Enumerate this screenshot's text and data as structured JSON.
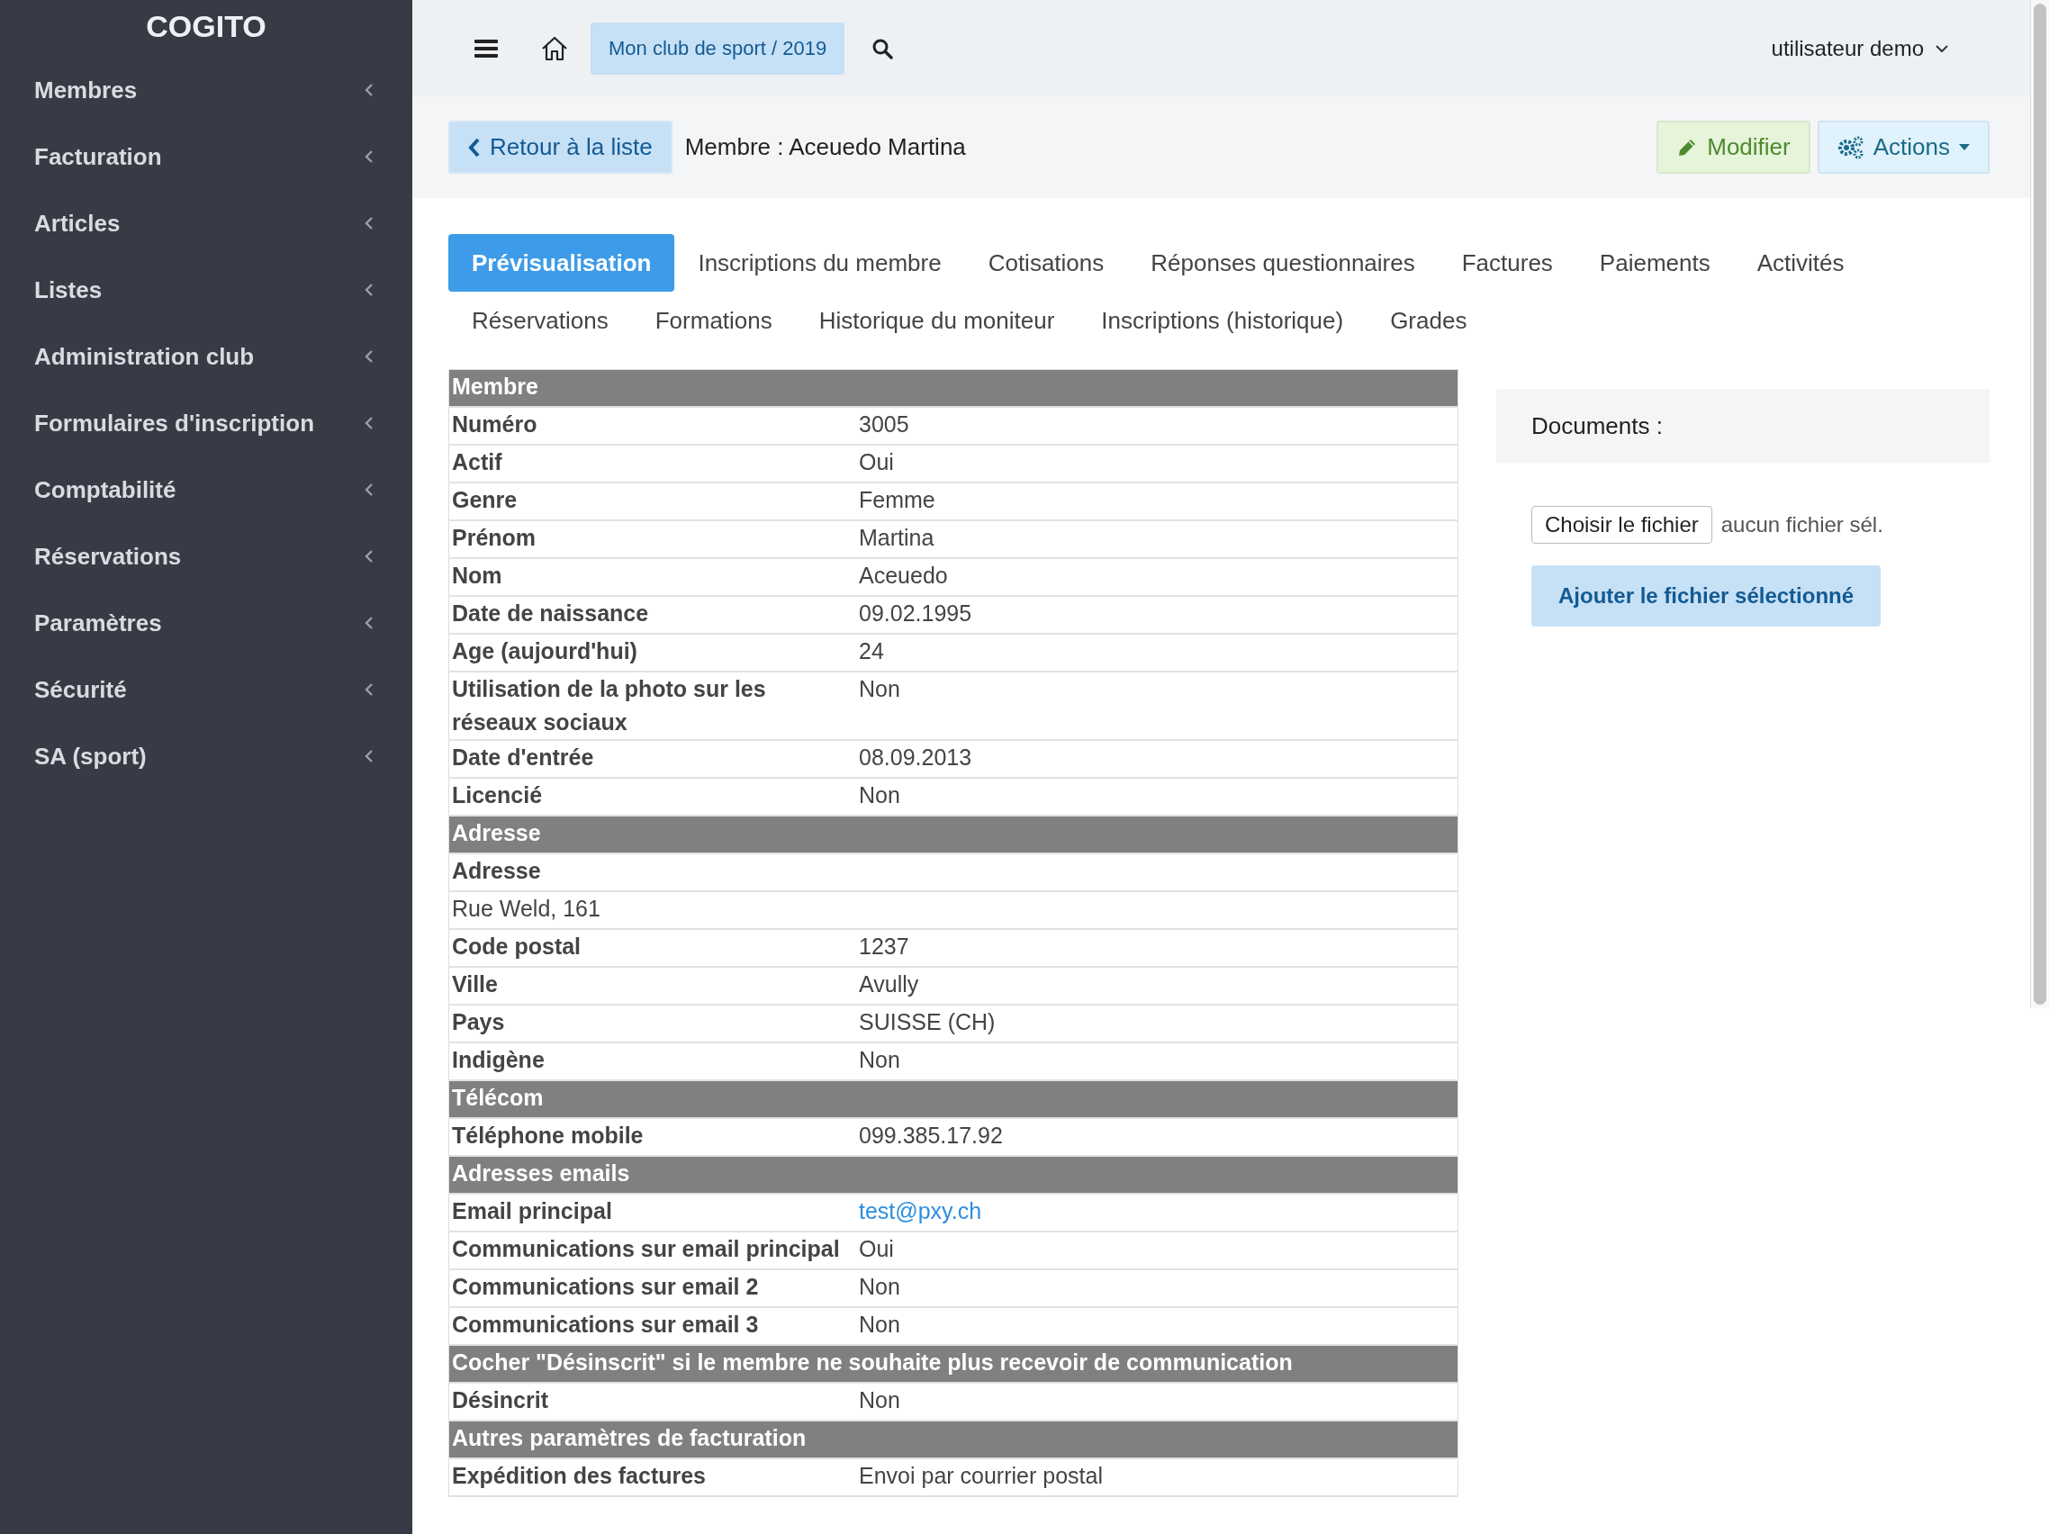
{
  "sidebar": {
    "brand": "COGITO",
    "items": [
      {
        "label": "Membres"
      },
      {
        "label": "Facturation"
      },
      {
        "label": "Articles"
      },
      {
        "label": "Listes"
      },
      {
        "label": "Administration club"
      },
      {
        "label": "Formulaires d'inscription"
      },
      {
        "label": "Comptabilité"
      },
      {
        "label": "Réservations"
      },
      {
        "label": "Paramètres"
      },
      {
        "label": "Sécurité"
      },
      {
        "label": "SA (sport)"
      }
    ]
  },
  "topbar": {
    "context": "Mon club de sport / 2019",
    "user": "utilisateur demo"
  },
  "header": {
    "back_button": "Retour à la liste",
    "title": "Membre : Aceuedo Martina",
    "edit_button": "Modifier",
    "actions_button": "Actions"
  },
  "tab_rows": [
    {
      "tabs": [
        {
          "label": "Prévisualisation",
          "selected": true
        },
        {
          "label": "Inscriptions du membre",
          "selected": false
        },
        {
          "label": "Cotisations",
          "selected": false
        },
        {
          "label": "Réponses questionnaires",
          "selected": false
        },
        {
          "label": "Factures",
          "selected": false
        },
        {
          "label": "Paiements",
          "selected": false
        },
        {
          "label": "Activités",
          "selected": false
        }
      ]
    },
    {
      "tabs": [
        {
          "label": "Réservations",
          "selected": false
        },
        {
          "label": "Formations",
          "selected": false
        },
        {
          "label": "Historique du moniteur",
          "selected": false
        },
        {
          "label": "Inscriptions (historique)",
          "selected": false
        },
        {
          "label": "Grades",
          "selected": false
        }
      ]
    }
  ],
  "table": {
    "rows": [
      {
        "kind": "section",
        "label": "Membre"
      },
      {
        "kind": "field",
        "label": "Numéro",
        "value": "3005"
      },
      {
        "kind": "field",
        "label": "Actif",
        "value": "Oui"
      },
      {
        "kind": "field",
        "label": "Genre",
        "value": "Femme"
      },
      {
        "kind": "field",
        "label": "Prénom",
        "value": "Martina"
      },
      {
        "kind": "field",
        "label": "Nom",
        "value": "Aceuedo"
      },
      {
        "kind": "field",
        "label": "Date de naissance",
        "value": "09.02.1995"
      },
      {
        "kind": "field",
        "label": "Age (aujourd'hui)",
        "value": "24"
      },
      {
        "kind": "field",
        "label": "Utilisation de la photo sur les réseaux sociaux",
        "value": "Non"
      },
      {
        "kind": "field",
        "label": "Date d'entrée",
        "value": "08.09.2013"
      },
      {
        "kind": "field",
        "label": "Licencié",
        "value": "Non"
      },
      {
        "kind": "section",
        "label": "Adresse"
      },
      {
        "kind": "field",
        "label": "Adresse"
      },
      {
        "kind": "text",
        "label": "Rue Weld, 161"
      },
      {
        "kind": "field",
        "label": "Code postal",
        "value": "1237"
      },
      {
        "kind": "field",
        "label": "Ville",
        "value": "Avully"
      },
      {
        "kind": "field",
        "label": "Pays",
        "value": "SUISSE (CH)"
      },
      {
        "kind": "field",
        "label": "Indigène",
        "value": "Non"
      },
      {
        "kind": "section",
        "label": "Télécom"
      },
      {
        "kind": "field",
        "label": "Téléphone mobile",
        "value": "099.385.17.92"
      },
      {
        "kind": "section",
        "label": "Adresses emails"
      },
      {
        "kind": "link",
        "label": "Email principal",
        "value": "test@pxy.ch"
      },
      {
        "kind": "field",
        "label": "Communications sur email principal",
        "value": "Oui"
      },
      {
        "kind": "field",
        "label": "Communications sur email 2",
        "value": "Non"
      },
      {
        "kind": "field",
        "label": "Communications sur email 3",
        "value": "Non"
      },
      {
        "kind": "section",
        "label": "Cocher \"Désinscrit\" si le membre ne souhaite plus recevoir de communication"
      },
      {
        "kind": "field",
        "label": "Désincrit",
        "value": "Non"
      },
      {
        "kind": "section",
        "label": "Autres paramètres de facturation"
      },
      {
        "kind": "field",
        "label": "Expédition des factures",
        "value": "Envoi par courrier postal"
      }
    ]
  },
  "documents": {
    "title": "Documents :",
    "file_button": "Choisir le fichier",
    "file_status": "aucun fichier sél.",
    "upload_button": "Ajouter le fichier sélectionné"
  }
}
